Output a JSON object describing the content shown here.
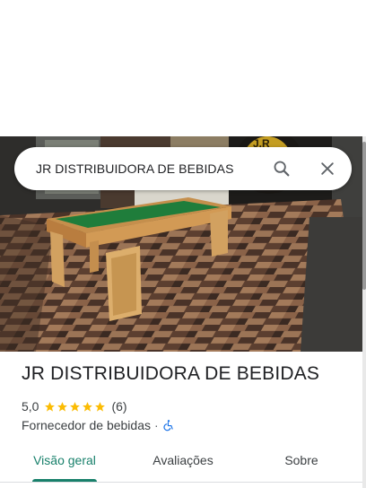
{
  "search": {
    "query": "JR DISTRIBUIDORA DE BEBIDAS",
    "search_icon": "search-icon",
    "close_icon": "close-icon"
  },
  "hero": {
    "sign_text": "J.R"
  },
  "place": {
    "name": "JR DISTRIBUIDORA DE BEBIDAS",
    "rating": "5,0",
    "stars": 5,
    "review_count": "(6)",
    "category": "Fornecedor de bebidas",
    "separator": "·",
    "accessibility_icon": "wheelchair-icon"
  },
  "tabs": [
    {
      "label": "Visão geral",
      "active": true
    },
    {
      "label": "Avaliações",
      "active": false
    },
    {
      "label": "Sobre",
      "active": false
    }
  ],
  "colors": {
    "accent": "#18806b",
    "star": "#fbbc04",
    "accessibility": "#1a73e8"
  }
}
